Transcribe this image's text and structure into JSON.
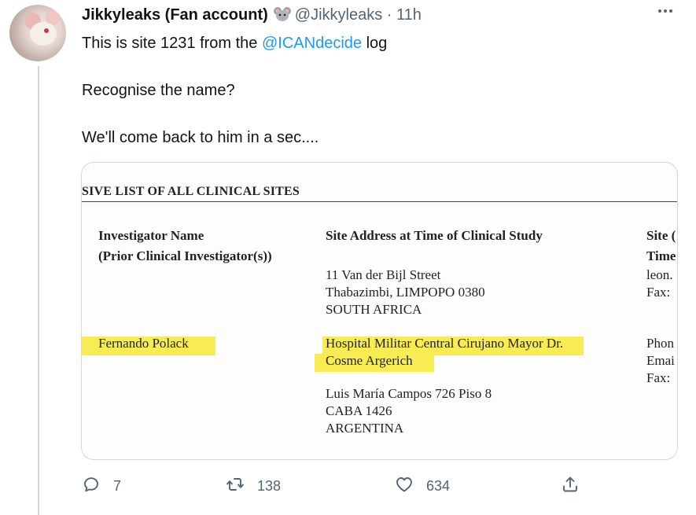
{
  "tweet": {
    "author_name": "Jikkyleaks (Fan account)",
    "handle": "@Jikkyleaks",
    "separator": "·",
    "time": "11h",
    "text_before_mention": "This is site 1231 from the ",
    "mention": "@ICANdecide",
    "text_after_mention": " log",
    "line2": "Recognise the name?",
    "line3": "We'll come back to him in a sec...."
  },
  "document": {
    "heading": "SIVE LIST OF ALL CLINICAL SITES",
    "col1_header_1": "Investigator Name",
    "col1_header_2": "(Prior Clinical Investigator(s))",
    "col2_header": "Site Address at Time of Clinical Study",
    "col3_header_1": "Site (",
    "col3_header_2": "Time",
    "addr1_line1": "11 Van der Bijl Street",
    "addr1_line2": "Thabazimbi, LIMPOPO 0380",
    "addr1_line3": "SOUTH AFRICA",
    "contact1_line1": "leon.",
    "contact1_line2": "Fax:",
    "investigator2": "Fernando Polack",
    "addr2_line1": "Hospital Militar Central Cirujano Mayor Dr.",
    "addr2_line2": "Cosme Argerich",
    "addr2_line3": "Luis María Campos 726 Piso 8",
    "addr2_line4": "CABA 1426",
    "addr2_line5": "ARGENTINA",
    "contact2_line1": "Phon",
    "contact2_line2": "Emai",
    "contact2_line3": "Fax:",
    "highlight_color": "#f8ec55"
  },
  "actions": {
    "reply_count": "7",
    "retweet_count": "138",
    "like_count": "634"
  },
  "icons": {
    "more": "more-horizontal-icon",
    "mouse": "mouse-emoji-icon",
    "reply": "reply-icon",
    "retweet": "retweet-icon",
    "like": "heart-icon",
    "share": "share-icon"
  },
  "colors": {
    "accent": "#1d9bf0",
    "muted": "#536471",
    "text": "#0f1419",
    "border": "#cfd9de"
  }
}
